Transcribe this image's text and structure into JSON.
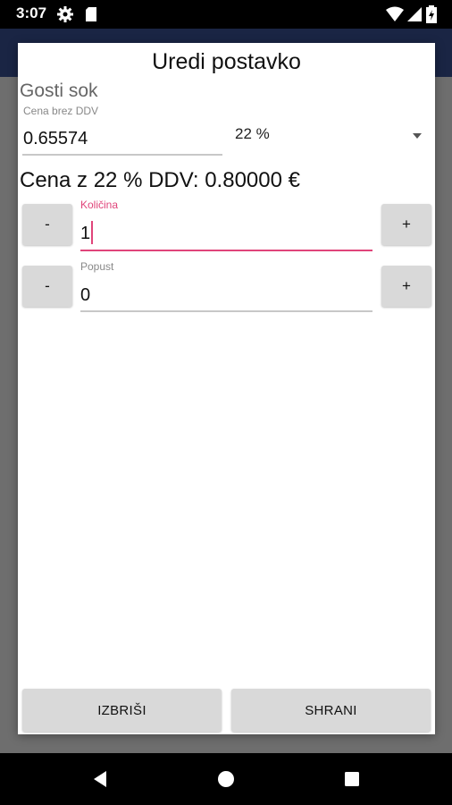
{
  "status_bar": {
    "time": "3:07",
    "icons": [
      "gear-icon",
      "sd-card-icon",
      "wifi-icon",
      "signal-icon",
      "battery-icon"
    ]
  },
  "dialog": {
    "title": "Uredi postavko",
    "item_name": "Gosti sok",
    "price_field": {
      "label": "Cena brez DDV",
      "value": "0.65574"
    },
    "vat_select": {
      "selected": "22 %"
    },
    "total_line": "Cena z 22 % DDV: 0.80000 €",
    "quantity": {
      "label": "Količina",
      "value": "1",
      "minus_label": "-",
      "plus_label": "+"
    },
    "discount": {
      "label": "Popust",
      "value": "0",
      "minus_label": "-",
      "plus_label": "+"
    },
    "buttons": {
      "delete_label": "IZBRIŠI",
      "save_label": "SHRANI"
    }
  },
  "nav_bar": {
    "icons": [
      "back-icon",
      "home-icon",
      "recents-icon"
    ]
  },
  "colors": {
    "accent": "#e0447a",
    "app_bar": "#1a2544",
    "button_bg": "#d9d9d9"
  }
}
